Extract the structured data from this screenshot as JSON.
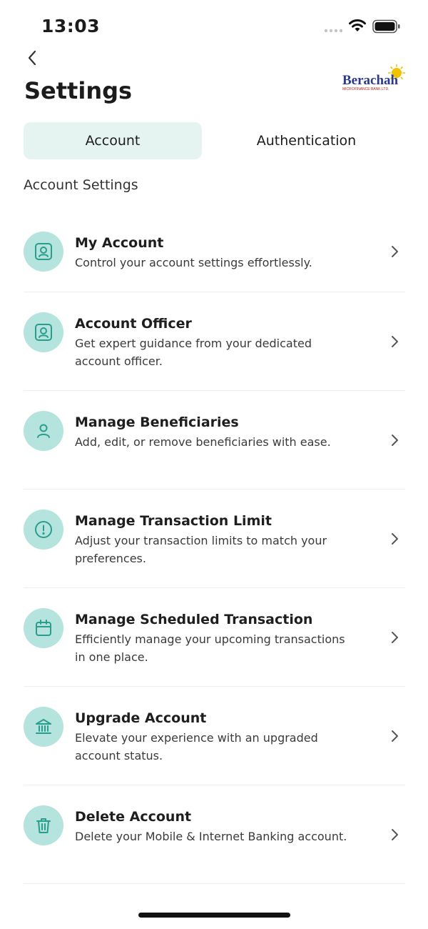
{
  "status_bar": {
    "time": "13:03"
  },
  "header": {
    "title": "Settings",
    "logo_text": "Berachah",
    "logo_subtext": "MICROFINANCE BANK LTD."
  },
  "tabs": [
    {
      "label": "Account",
      "active": true
    },
    {
      "label": "Authentication",
      "active": false
    }
  ],
  "section_label": "Account Settings",
  "items": [
    {
      "title": "My Account",
      "description": "Control your account settings effortlessly.",
      "icon": "id-card-icon"
    },
    {
      "title": "Account Officer",
      "description": "Get expert guidance from your dedicated account officer.",
      "icon": "id-card-icon"
    },
    {
      "title": "Manage Beneficiaries",
      "description": "Add, edit, or remove beneficiaries with ease.",
      "icon": "user-icon"
    },
    {
      "title": "Manage Transaction Limit",
      "description": "Adjust your transaction limits to match your preferences.",
      "icon": "alert-circle-icon"
    },
    {
      "title": "Manage Scheduled Transaction",
      "description": "Efficiently manage your upcoming transactions in one place.",
      "icon": "calendar-icon"
    },
    {
      "title": "Upgrade Account",
      "description": "Elevate your experience with an upgraded account status.",
      "icon": "bank-icon"
    },
    {
      "title": "Delete Account",
      "description": "Delete your Mobile & Internet Banking account.",
      "icon": "trash-icon"
    }
  ],
  "colors": {
    "accent": "#2a9d8f",
    "icon_bg": "#b4e4dd",
    "tab_active_bg": "#e6f4f1"
  }
}
